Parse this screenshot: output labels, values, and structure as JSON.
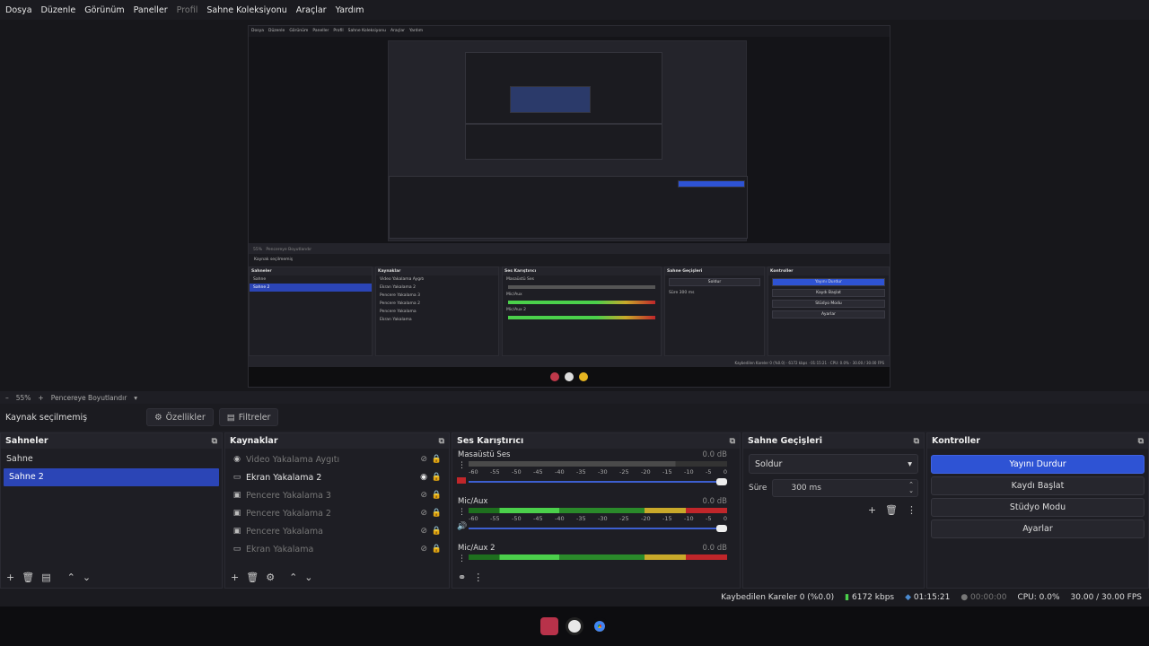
{
  "menu": [
    "Dosya",
    "Düzenle",
    "Görünüm",
    "Paneller",
    "Profil",
    "Sahne Koleksiyonu",
    "Araçlar",
    "Yardım"
  ],
  "toolbar": {
    "zoom": "55%",
    "fit": "Pencereye Boyutlandır"
  },
  "context": {
    "no_source": "Kaynak seçilmemiş",
    "properties": "Özellikler",
    "filters": "Filtreler"
  },
  "scenes": {
    "title": "Sahneler",
    "items": [
      "Sahne",
      "Sahne 2"
    ],
    "selected": 1
  },
  "sources": {
    "title": "Kaynaklar",
    "items": [
      {
        "name": "Video Yakalama Aygıtı",
        "icon": "camera-icon",
        "visible": false
      },
      {
        "name": "Ekran Yakalama 2",
        "icon": "monitor-icon",
        "visible": true
      },
      {
        "name": "Pencere Yakalama 3",
        "icon": "window-icon",
        "visible": false
      },
      {
        "name": "Pencere Yakalama 2",
        "icon": "window-icon",
        "visible": false
      },
      {
        "name": "Pencere Yakalama",
        "icon": "window-icon",
        "visible": false
      },
      {
        "name": "Ekran Yakalama",
        "icon": "monitor-icon",
        "visible": false
      }
    ]
  },
  "mixer": {
    "title": "Ses Karıştırıcı",
    "channels": [
      {
        "name": "Masaüstü Ses",
        "db": "0.0 dB",
        "active": false
      },
      {
        "name": "Mic/Aux",
        "db": "0.0 dB",
        "active": true
      },
      {
        "name": "Mic/Aux 2",
        "db": "0.0 dB",
        "active": true
      }
    ],
    "scale": [
      "-60",
      "-55",
      "-50",
      "-45",
      "-40",
      "-35",
      "-30",
      "-25",
      "-20",
      "-15",
      "-10",
      "-5",
      "0"
    ]
  },
  "transitions": {
    "title": "Sahne Geçişleri",
    "selected": "Soldur",
    "duration_label": "Süre",
    "duration": "300 ms"
  },
  "controls": {
    "title": "Kontroller",
    "buttons": [
      "Yayını Durdur",
      "Kaydı Başlat",
      "Stüdyo Modu",
      "Ayarlar"
    ]
  },
  "status": {
    "dropped": "Kaybedilen Kareler 0 (%0.0)",
    "bitrate": "6172 kbps",
    "stream_time": "01:15:21",
    "rec_time": "00:00:00",
    "cpu": "CPU: 0.0%",
    "fps": "30.00 / 30.00 FPS"
  },
  "colors": {
    "accent": "#2e53d4",
    "selected": "#2b45b6",
    "meter_green": "#4bd04b",
    "meter_yellow": "#c9a92a",
    "meter_red": "#c0262a"
  }
}
